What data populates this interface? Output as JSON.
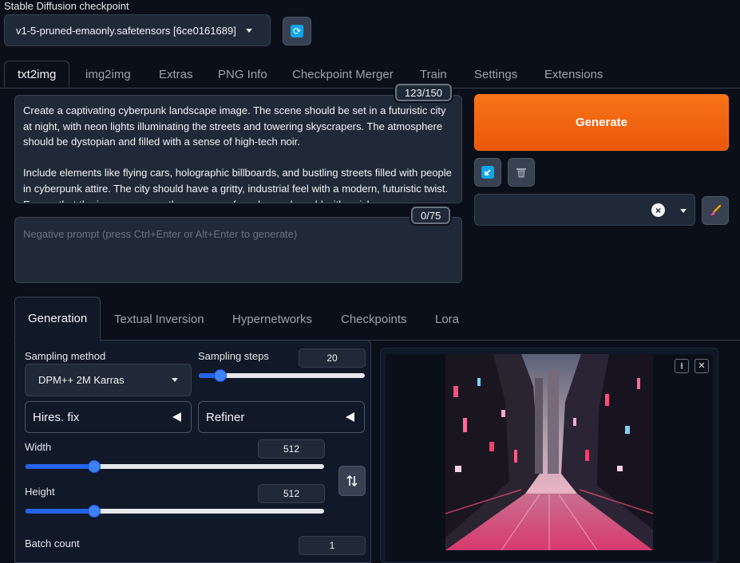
{
  "checkpoint": {
    "label": "Stable Diffusion checkpoint",
    "selected": "v1-5-pruned-emaonly.safetensors [6ce0161689]"
  },
  "main_tabs": [
    "txt2img",
    "img2img",
    "Extras",
    "PNG Info",
    "Checkpoint Merger",
    "Train",
    "Settings",
    "Extensions"
  ],
  "prompt": {
    "token_count": "123/150",
    "paragraph1": "Create a captivating cyberpunk landscape image. The scene should be set in a futuristic city at night, with neon lights illuminating the streets and towering skyscrapers. The atmosphere should be dystopian and filled with a sense of high-tech noir.",
    "paragraph2": "Include elements like flying cars, holographic billboards, and bustling streets filled with people in cyberpunk attire. The city should have a gritty, industrial feel with a modern, futuristic twist. Ensure that the image conveys the essence of a cyberpunk world with a rich"
  },
  "negative_prompt": {
    "token_count": "0/75",
    "placeholder": "Negative prompt (press Ctrl+Enter or Alt+Enter to generate)"
  },
  "generate_label": "Generate",
  "sub_tabs": [
    "Generation",
    "Textual Inversion",
    "Hypernetworks",
    "Checkpoints",
    "Lora"
  ],
  "generation": {
    "sampling_method_label": "Sampling method",
    "sampling_method_value": "DPM++ 2M Karras",
    "sampling_steps_label": "Sampling steps",
    "sampling_steps_value": "20",
    "sampling_steps_fraction": 0.13,
    "hires_fix_label": "Hires. fix",
    "refiner_label": "Refiner",
    "width_label": "Width",
    "width_value": "512",
    "width_fraction": 0.23,
    "height_label": "Height",
    "height_value": "512",
    "height_fraction": 0.23,
    "batch_count_label": "Batch count",
    "batch_count_value": "1"
  },
  "icons": {
    "refresh": "refresh-icon",
    "paste": "arrow-down-left-icon",
    "trash": "trash-icon",
    "clear": "clear-x-icon",
    "brush": "paintbrush-icon",
    "swap": "swap-vertical-icon",
    "download": "download-icon",
    "close": "close-icon"
  },
  "colors": {
    "accent": "#f97316",
    "slider": "#2563eb",
    "background": "#0b0f19",
    "panel": "#1f2937"
  }
}
